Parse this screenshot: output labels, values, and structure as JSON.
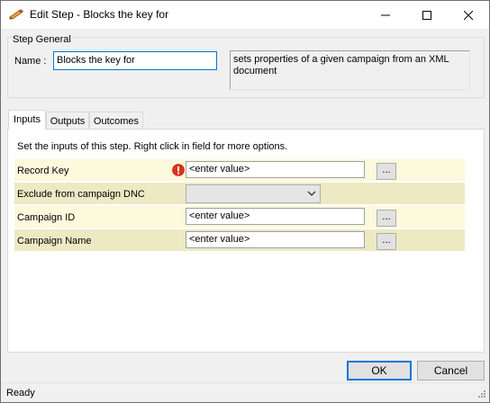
{
  "window": {
    "title": "Edit Step - Blocks the key for"
  },
  "icons": {
    "app": "pencil-icon",
    "minimize": "minimize-icon",
    "maximize": "maximize-icon",
    "close": "close-icon",
    "warning": "warning-icon",
    "dropdown": "chevron-down-icon"
  },
  "step_general": {
    "group_label": "Step General",
    "name_label": "Name :",
    "name_value": "Blocks the key for",
    "description": "sets properties of a given campaign from an XML document"
  },
  "tabs": [
    {
      "label": "Inputs",
      "active": true
    },
    {
      "label": "Outputs",
      "active": false
    },
    {
      "label": "Outcomes",
      "active": false
    }
  ],
  "inputs_panel": {
    "instructions": "Set the inputs of this step.  Right click in field for more options.",
    "rows": [
      {
        "label": "Record Key",
        "value": "<enter value>",
        "button": "...",
        "warning": true
      },
      {
        "label": "Exclude from campaign DNC",
        "value": "",
        "type": "dropdown"
      },
      {
        "label": "Campaign ID",
        "value": "<enter value>",
        "button": "..."
      },
      {
        "label": "Campaign Name",
        "value": "<enter value>",
        "button": "..."
      }
    ]
  },
  "buttons": {
    "ok": "OK",
    "cancel": "Cancel"
  },
  "status": {
    "text": "Ready"
  },
  "colors": {
    "row_light": "#fcf9dc",
    "row_dark": "#ede9c3",
    "focus_border": "#0078d7",
    "warning": "#e0301e"
  }
}
